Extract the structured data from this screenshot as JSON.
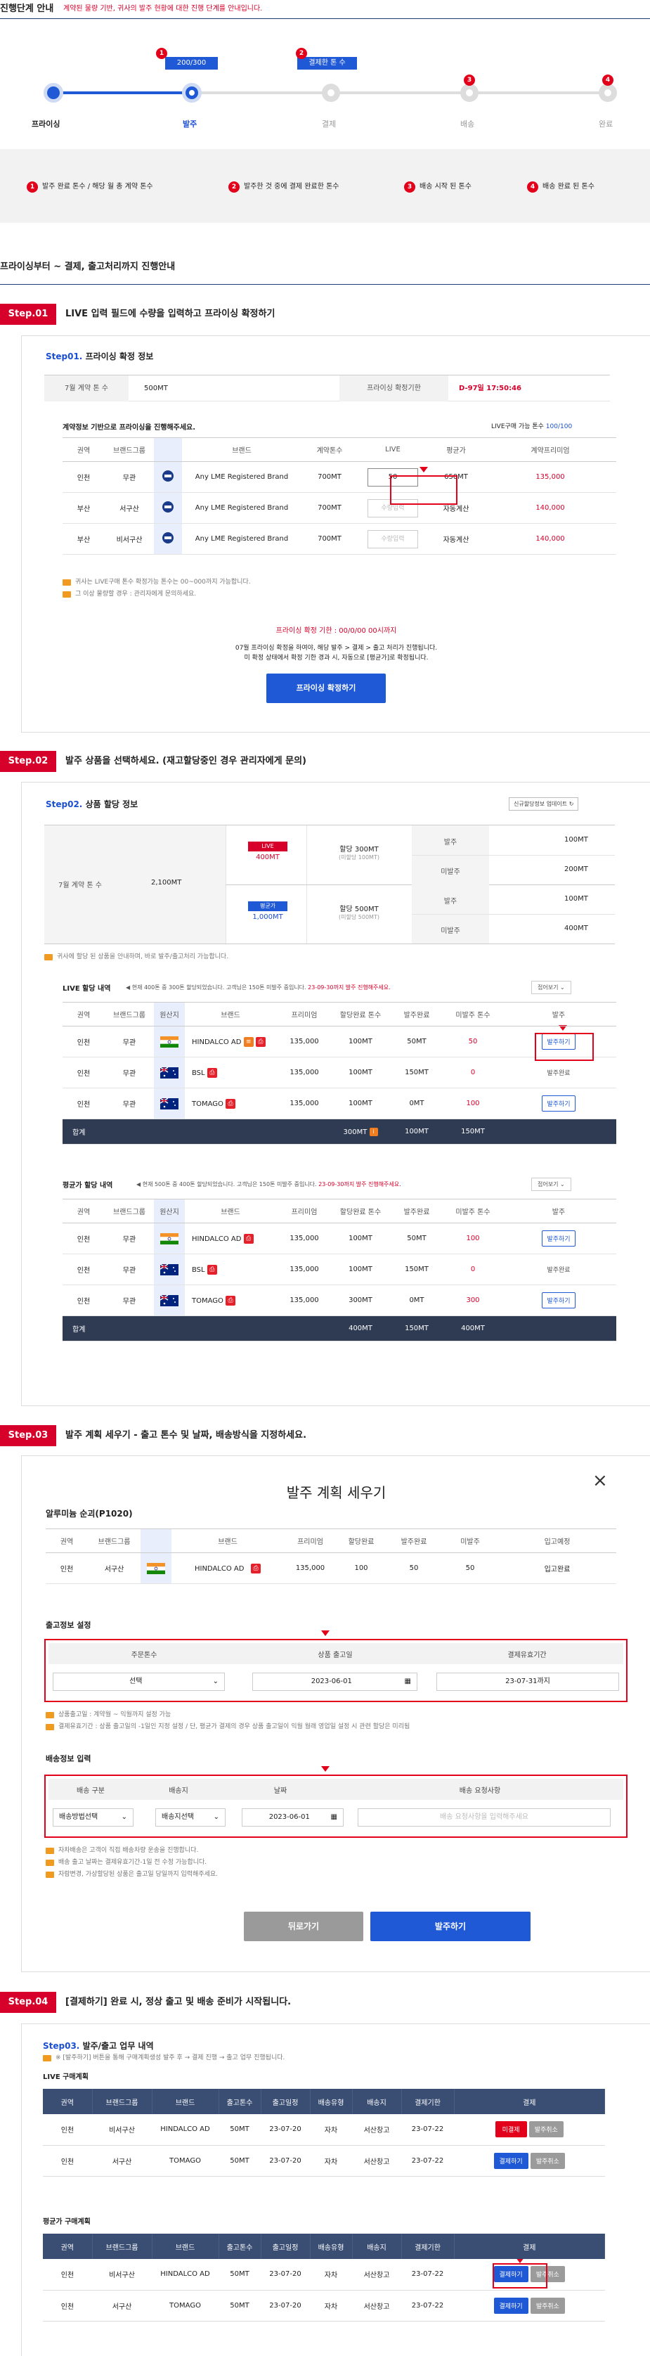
{
  "header": {
    "title": "진행단계 안내",
    "desc": "계약된 물량 기반, 귀사의 발주 현황에 대한 진행 단계를 안내입니다."
  },
  "progress": {
    "steps": [
      "프라이싱",
      "발주",
      "결제",
      "배송",
      "완료"
    ],
    "bubble1_label": "200/300",
    "bubble2_label": "결제한 톤 수",
    "badges": [
      "1",
      "2",
      "3",
      "4"
    ],
    "legend": [
      {
        "n": "1",
        "text": "발주 완료 톤수 / 해당 월 총 계약 톤수"
      },
      {
        "n": "2",
        "text": "발주한 것 중에 결제 완료한 톤수"
      },
      {
        "n": "3",
        "text": "배송 시작 된 톤수"
      },
      {
        "n": "4",
        "text": "배송 완료 된 톤수"
      }
    ]
  },
  "section_title": "프라이싱부터 ~ 결제, 출고처리까지 진행안내",
  "step1": {
    "tag": "Step.01",
    "title": "LIVE 입력 필드에 수량을 입력하고 프라이싱 확정하기",
    "card_title_prefix": "Step01.",
    "card_title": "프라이싱 확정 정보",
    "contract_label": "7월 계약 톤 수",
    "contract_value": "500MT",
    "deadline_label": "프라이싱 확정기한",
    "deadline_value": "D-97일 17:50:46",
    "table_caption": "계약정보 기반으로 프라이싱을 진행해주세요.",
    "live_avail_label": "LIVE구매 가능 톤수",
    "live_avail_value": "100/100",
    "columns": [
      "권역",
      "브랜드그룹",
      "",
      "브랜드",
      "계약톤수",
      "LIVE",
      "평균가",
      "계약프리미엄"
    ],
    "rows": [
      {
        "region": "인천",
        "group": "무관",
        "brand": "Any LME Registered Brand",
        "tons": "700MT",
        "live": "50",
        "avg": "650MT",
        "premium": "135,000"
      },
      {
        "region": "부산",
        "group": "서구산",
        "brand": "Any LME Registered Brand",
        "tons": "700MT",
        "live": "수량입력",
        "avg": "자동계산",
        "premium": "140,000"
      },
      {
        "region": "부산",
        "group": "비서구산",
        "brand": "Any LME Registered Brand",
        "tons": "700MT",
        "live": "수량입력",
        "avg": "자동계산",
        "premium": "140,000"
      }
    ],
    "notes": [
      "귀사는 LIVE구매 톤수 확정가능 톤수는 00~000까지 가능합니다.",
      "그 이상 물량할 경우 : 관리자에게 문의하세요."
    ],
    "deadline_note": "프라이싱 확정 기한 : 00/0/00 00시까지",
    "info_lines": [
      "07월 프라이싱 확정을 하여야, 해당 발주 > 결제 > 출고 처리가 진행됩니다.",
      "미 확정 상태에서 확정 기한 경과 시, 자동으로 [평균가]로 확정됩니다."
    ],
    "button": "프라이싱 확정하기"
  },
  "step2": {
    "tag": "Step.02",
    "title": "발주 상품을 선택하세요. (재고할당중인 경우 관리자에게 문의)",
    "card_title_prefix": "Step02.",
    "card_title": "상품 할당 정보",
    "refresh_btn": "신규할당정보 업데이트",
    "contract_label": "7월 계약 톤 수",
    "contract_value": "2,100MT",
    "live_badge": "LIVE",
    "live_value": "400MT",
    "avg_badge": "평균가",
    "avg_value": "1,000MT",
    "alloc1": "할당 300MT",
    "alloc1_sub": "(미할당 100MT)",
    "alloc2": "할당 500MT",
    "alloc2_sub": "(미할당 500MT)",
    "right_rows": [
      {
        "k": "발주",
        "v": "100MT"
      },
      {
        "k": "미발주",
        "v": "200MT"
      },
      {
        "k": "발주",
        "v": "100MT"
      },
      {
        "k": "미발주",
        "v": "400MT"
      }
    ],
    "note": "귀사에 할당 된 상품을 안내하며, 바로 발주/출고처리 가능합니다.",
    "live_label": "LIVE 할당 내역",
    "live_info": "현재 400톤 중 300톤 할당되었습니다. 고객님은 150톤 미발주 중입니다.",
    "live_info_red": "23-09-30까지 발주 진행해주세요.",
    "fold": "접어보기",
    "columns": [
      "권역",
      "브랜드그룹",
      "원산지",
      "브랜드",
      "프리미엄",
      "할당완료 톤수",
      "발주완료",
      "미발주 톤수",
      "발주"
    ],
    "live_rows": [
      {
        "region": "인천",
        "group": "무관",
        "brand": "HINDALCO AD",
        "prem": "135,000",
        "alloc": "100MT",
        "done": "50MT",
        "remain": "50",
        "action": "발주하기",
        "flag": "in"
      },
      {
        "region": "인천",
        "group": "무관",
        "brand": "BSL",
        "prem": "135,000",
        "alloc": "100MT",
        "done": "150MT",
        "remain": "0",
        "action": "발주완료",
        "flag": "au"
      },
      {
        "region": "인천",
        "group": "무관",
        "brand": "TOMAGO",
        "prem": "135,000",
        "alloc": "100MT",
        "done": "0MT",
        "remain": "100",
        "action": "발주하기",
        "flag": "au"
      }
    ],
    "live_sum": {
      "label": "합계",
      "alloc": "300MT",
      "done": "100MT",
      "remain": "150MT"
    },
    "avg_label": "평균가 할당 내역",
    "avg_info": "현재 500톤 중 400톤 할당되었습니다. 고객님은 150톤 미발주 중입니다.",
    "avg_info_red": "23-09-30까지 발주 진행해주세요.",
    "avg_rows": [
      {
        "region": "인천",
        "group": "무관",
        "brand": "HINDALCO AD",
        "prem": "135,000",
        "alloc": "100MT",
        "done": "50MT",
        "remain": "100",
        "action": "발주하기",
        "flag": "in"
      },
      {
        "region": "인천",
        "group": "무관",
        "brand": "BSL",
        "prem": "135,000",
        "alloc": "100MT",
        "done": "150MT",
        "remain": "0",
        "action": "발주완료",
        "flag": "au"
      },
      {
        "region": "인천",
        "group": "무관",
        "brand": "TOMAGO",
        "prem": "135,000",
        "alloc": "300MT",
        "done": "0MT",
        "remain": "300",
        "action": "발주하기",
        "flag": "au"
      }
    ],
    "avg_sum": {
      "label": "합계",
      "alloc": "400MT",
      "done": "150MT",
      "remain": "400MT"
    }
  },
  "step3": {
    "tag": "Step.03",
    "title": "발주 계획 세우기 - 출고 톤수 및 날짜, 배송방식을 지정하세요.",
    "modal_title": "발주 계획 세우기",
    "product": "알루미늄 순괴(P1020)",
    "columns": [
      "권역",
      "브랜드그룹",
      "",
      "브랜드",
      "프리미엄",
      "할당완료",
      "발주완료",
      "미발주",
      "입고예정"
    ],
    "row": {
      "region": "인천",
      "group": "서구산",
      "brand": "HINDALCO AD",
      "prem": "135,000",
      "alloc": "100",
      "done": "50",
      "remain": "50",
      "status": "입고완료"
    },
    "ship_title": "출고정보 설정",
    "ship_cols": [
      "주문톤수",
      "상품 출고일",
      "결제유효기간"
    ],
    "ship_vals": [
      "선택",
      "2023-06-01",
      "23-07-31까지"
    ],
    "ship_notes": [
      "상품출고일 : 계약월 ~ 익월까지 설정 가능",
      "결제유효기간 : 상품 출고일의 -1일인 지정 설정 / 단, 평균가 결제의 경우 상품 출고일이 익월 월래 영업일 설정 시 관련 할당은 미리됨"
    ],
    "deliv_title": "배송정보 입력",
    "deliv_cols": [
      "배송 구분",
      "배송지",
      "날짜",
      "배송 요청사항"
    ],
    "deliv_vals": [
      "배송방법선택",
      "배송지선택",
      "2023-06-01",
      "배송 요청사항을 입력해주세요"
    ],
    "deliv_notes": [
      "자차배송은 고객이 직접 배송차량 운송을 진행합니다.",
      "배송 출고 날짜는 결제유효기간-1일 전 수정 가능합니다.",
      "자람변경, 가상할당된 상품은 출고일 당일까지 입력해주세요."
    ],
    "back_btn": "뒤로가기",
    "order_btn": "발주하기"
  },
  "step4": {
    "tag": "Step.04",
    "title": "[결제하기] 완료 시, 정상 출고 및 배송 준비가 시작됩니다.",
    "card_title_prefix": "Step03.",
    "card_title": "발주/출고 업무 내역",
    "note": "※ [발주하기] 버튼을 통해 구매계획생성 발주 후 → 결제 진행 → 출고 업무 진행됩니다.",
    "live_label": "LIVE 구매계획",
    "avg_label": "평균가 구매계획",
    "columns": [
      "권역",
      "브랜드그룹",
      "브랜드",
      "출고톤수",
      "출고일정",
      "배송유형",
      "배송지",
      "결제기한",
      "결제"
    ],
    "live_rows": [
      {
        "region": "인천",
        "group": "비서구산",
        "brand": "HINDALCO AD",
        "tons": "50MT",
        "date": "23-07-20",
        "type": "자차",
        "dest": "서산창고",
        "due": "23-07-22",
        "pay": "미결제",
        "cancel": "발주취소"
      },
      {
        "region": "인천",
        "group": "서구산",
        "brand": "TOMAGO",
        "tons": "50MT",
        "date": "23-07-20",
        "type": "자차",
        "dest": "서산창고",
        "due": "23-07-22",
        "pay": "결제하기",
        "cancel": "발주취소"
      }
    ],
    "avg_rows": [
      {
        "region": "인천",
        "group": "비서구산",
        "brand": "HINDALCO AD",
        "tons": "50MT",
        "date": "23-07-20",
        "type": "자차",
        "dest": "서산창고",
        "due": "23-07-22",
        "pay": "결제하기",
        "cancel": "발주취소"
      },
      {
        "region": "인천",
        "group": "서구산",
        "brand": "TOMAGO",
        "tons": "50MT",
        "date": "23-07-20",
        "type": "자차",
        "dest": "서산창고",
        "due": "23-07-22",
        "pay": "결제하기",
        "cancel": "발주취소"
      }
    ]
  }
}
